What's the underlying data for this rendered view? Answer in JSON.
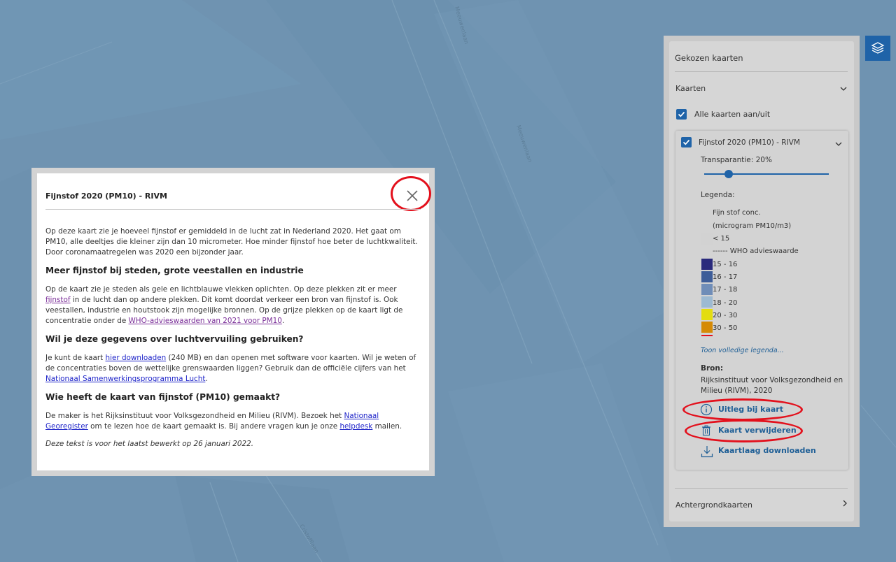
{
  "colors": {
    "map_bg": "#6f93b1",
    "accent": "#1f63a8",
    "highlight_ring": "#e3101c"
  },
  "map": {
    "street_labels": [
      "Meeuwenlaan",
      "Meeuwenlaan",
      "Cristofflaan"
    ]
  },
  "dialog": {
    "title": "Fijnstof 2020 (PM10) - RIVM",
    "close_icon": "close-icon",
    "intro": "Op deze kaart zie je hoeveel fijnstof er gemiddeld in de lucht zat in Nederland 2020. Het gaat om PM10, alle deeltjes die kleiner zijn dan 10 micrometer. Hoe minder fijnstof hoe beter de luchtkwaliteit. Door coronamaatregelen was 2020 een bijzonder jaar.",
    "h1": "Meer fijnstof bij steden, grote veestallen en industrie",
    "p1_a": "Op de kaart zie je steden als gele en lichtblauwe vlekken oplichten. Op deze plekken zit er meer ",
    "p1_link1": "fijnstof",
    "p1_b": " in de lucht dan op andere plekken. Dit komt doordat verkeer een bron van fijnstof is. Ook veestallen, industrie en houtstook zijn mogelijke bronnen. Op de grijze plekken op de kaart ligt de concentratie onder de ",
    "p1_link2": "WHO-advieswaarden van 2021 voor PM10",
    "p1_c": ".",
    "h2": "Wil je deze gegevens over luchtvervuiling gebruiken?",
    "p2_a": "Je kunt de kaart ",
    "p2_link1": "hier downloaden",
    "p2_b": " (240 MB) en dan openen met software voor kaarten. Wil je weten of de concentraties boven de wettelijke grenswaarden liggen? Gebruik dan de officiële cijfers van het ",
    "p2_link2": "Nationaal Samenwerkingsprogramma Lucht",
    "p2_c": ".",
    "h3": "Wie heeft de kaart van fijnstof (PM10) gemaakt?",
    "p3_a": "De maker is het Rijksinstituut voor Volksgezondheid en Milieu (RIVM). Bezoek het ",
    "p3_link1": "Nationaal Georegister",
    "p3_b": " om te lezen hoe de kaart gemaakt is. Bij andere vragen kun je onze ",
    "p3_link2": "helpdesk",
    "p3_c": " mailen.",
    "note": "Deze tekst is voor het laatst bewerkt op 26 januari 2022."
  },
  "panel": {
    "title": "Gekozen kaarten",
    "kaarten_label": "Kaarten",
    "all_toggle_label": "Alle kaarten aan/uit",
    "layer": {
      "name": "Fijnstof 2020 (PM10) - RIVM",
      "transparency_label": "Transparantie: 20%",
      "transparency_value": 0.2,
      "legend_label": "Legenda:",
      "legend_header_1": "Fijn stof conc.",
      "legend_header_2": "(microgram PM10/m3)",
      "legend_items": [
        {
          "label": "< 15",
          "color": "#d2d2d2"
        },
        {
          "label": "------ WHO advieswaarde",
          "color": ""
        },
        {
          "label": "15 - 16",
          "color": "#2a2a7c"
        },
        {
          "label": "16 - 17",
          "color": "#3d5d99"
        },
        {
          "label": "17 - 18",
          "color": "#6f8db8"
        },
        {
          "label": "18 - 20",
          "color": "#9dbad2"
        },
        {
          "label": "20 - 30",
          "color": "#e3dd10"
        },
        {
          "label": "30 - 50",
          "color": "#d58a06"
        }
      ],
      "full_legend_link": "Toon volledige legenda...",
      "source_label": "Bron:",
      "source_text": "Rijksinstituut voor Volksgezondheid en Milieu (RIVM), 2020",
      "info_link": "Uitleg bij kaart",
      "remove_link": "Kaart verwijderen",
      "download_link": "Kaartlaag downloaden"
    },
    "background_maps_label": "Achtergrondkaarten"
  },
  "layers_button_icon": "layers-icon"
}
